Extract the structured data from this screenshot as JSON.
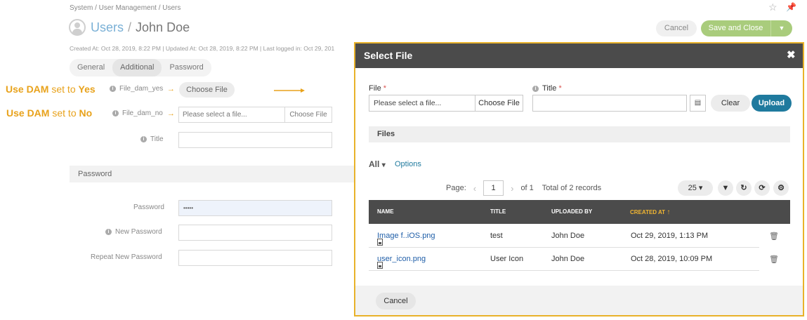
{
  "breadcrumb": "System / User Management / Users",
  "title": {
    "section": "Users",
    "separator": "/",
    "user": "John Doe"
  },
  "meta_line": "Created At: Oct 28, 2019, 8:22 PM  |  Updated At: Oct 28, 2019, 8:22 PM  |  Last logged in: Oct 29, 201",
  "tabs": [
    {
      "label": "General",
      "active": false
    },
    {
      "label": "Additional",
      "active": true
    },
    {
      "label": "Password",
      "active": false
    }
  ],
  "header_buttons": {
    "cancel": "Cancel",
    "save_and_close": "Save and Close",
    "dropdown": "▼"
  },
  "icons": {
    "star": "star-icon",
    "pin": "pin-icon",
    "close": "close-icon",
    "info": "info-icon"
  },
  "annotations": {
    "yes": {
      "prefix": "Use DAM",
      "middle": " set to ",
      "value": "Yes"
    },
    "no": {
      "prefix": "Use DAM",
      "middle": " set to ",
      "value": "No"
    },
    "accent_color": "#e8a21b"
  },
  "form": {
    "file_dam_yes": {
      "label": "File_dam_yes",
      "button": "Choose File"
    },
    "file_dam_no": {
      "label": "File_dam_no",
      "placeholder": "Please select a file...",
      "button": "Choose File"
    },
    "title": {
      "label": "Title"
    },
    "password_section": "Password",
    "password": {
      "label": "Password",
      "value": "•••••"
    },
    "new_password": {
      "label": "New Password"
    },
    "repeat_password": {
      "label": "Repeat New Password"
    }
  },
  "modal": {
    "title": "Select File",
    "close": "✖",
    "file_label": "File",
    "title_label": "Title",
    "required_mark": "*",
    "file_placeholder": "Please select a file...",
    "choose_file": "Choose File",
    "clear": "Clear",
    "upload": "Upload",
    "files_section": "Files",
    "view": "All",
    "view_caret": "▾",
    "options": "Options",
    "pager": {
      "page_label": "Page:",
      "page": "1",
      "of": "of 1",
      "total": "Total of 2 records"
    },
    "per_page": "25 ▾",
    "columns": [
      "NAME",
      "TITLE",
      "UPLOADED BY",
      "CREATED AT"
    ],
    "sort_indicator": "↑",
    "rows": [
      {
        "name": "Image f..iOS.png",
        "title": "test",
        "uploaded_by": "John Doe",
        "created_at": "Oct 29, 2019, 1:13 PM"
      },
      {
        "name": "user_icon.png",
        "title": "User Icon",
        "uploaded_by": "John Doe",
        "created_at": "Oct 28, 2019, 10:09 PM"
      }
    ],
    "cancel": "Cancel",
    "upload_color": "#1f7a9e",
    "highlight_border_color": "#e8b22a"
  }
}
